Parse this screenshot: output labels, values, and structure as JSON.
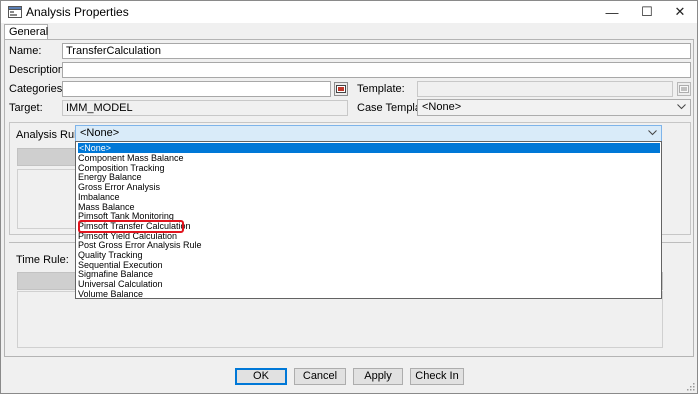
{
  "window": {
    "title": "Analysis Properties",
    "minimize": "—",
    "maximize": "☐",
    "close": "✕"
  },
  "tabs": [
    {
      "label": "General"
    }
  ],
  "form": {
    "name_label": "Name:",
    "name_value": "TransferCalculation",
    "description_label": "Description:",
    "description_value": "",
    "categories_label": "Categories:",
    "categories_value": "",
    "template_label": "Template:",
    "template_value": "",
    "target_label": "Target:",
    "target_value": "IMM_MODEL",
    "case_template_label": "Case Template:",
    "case_template_value": "<None>"
  },
  "analysis_rule": {
    "label": "Analysis Rule:",
    "selected": "<None>",
    "options": [
      "<None>",
      "Component Mass Balance",
      "Composition Tracking",
      "Energy Balance",
      "Gross Error Analysis",
      "Imbalance",
      "Mass Balance",
      "Pimsoft Tank Monitoring",
      "Pimsoft Transfer Calculation",
      "Pimsoft Yield Calculation",
      "Post Gross Error Analysis Rule",
      "Quality Tracking",
      "Sequential Execution",
      "Sigmafine Balance",
      "Universal Calculation",
      "Volume Balance"
    ],
    "highlighted": "Pimsoft Transfer Calculation"
  },
  "time_rule": {
    "label": "Time Rule:"
  },
  "buttons": {
    "ok": "OK",
    "cancel": "Cancel",
    "apply": "Apply",
    "check_in": "Check In"
  },
  "colors": {
    "selection": "#0078d7",
    "highlight_box": "#e0141e",
    "combo_focus": "#d9ebf9"
  }
}
